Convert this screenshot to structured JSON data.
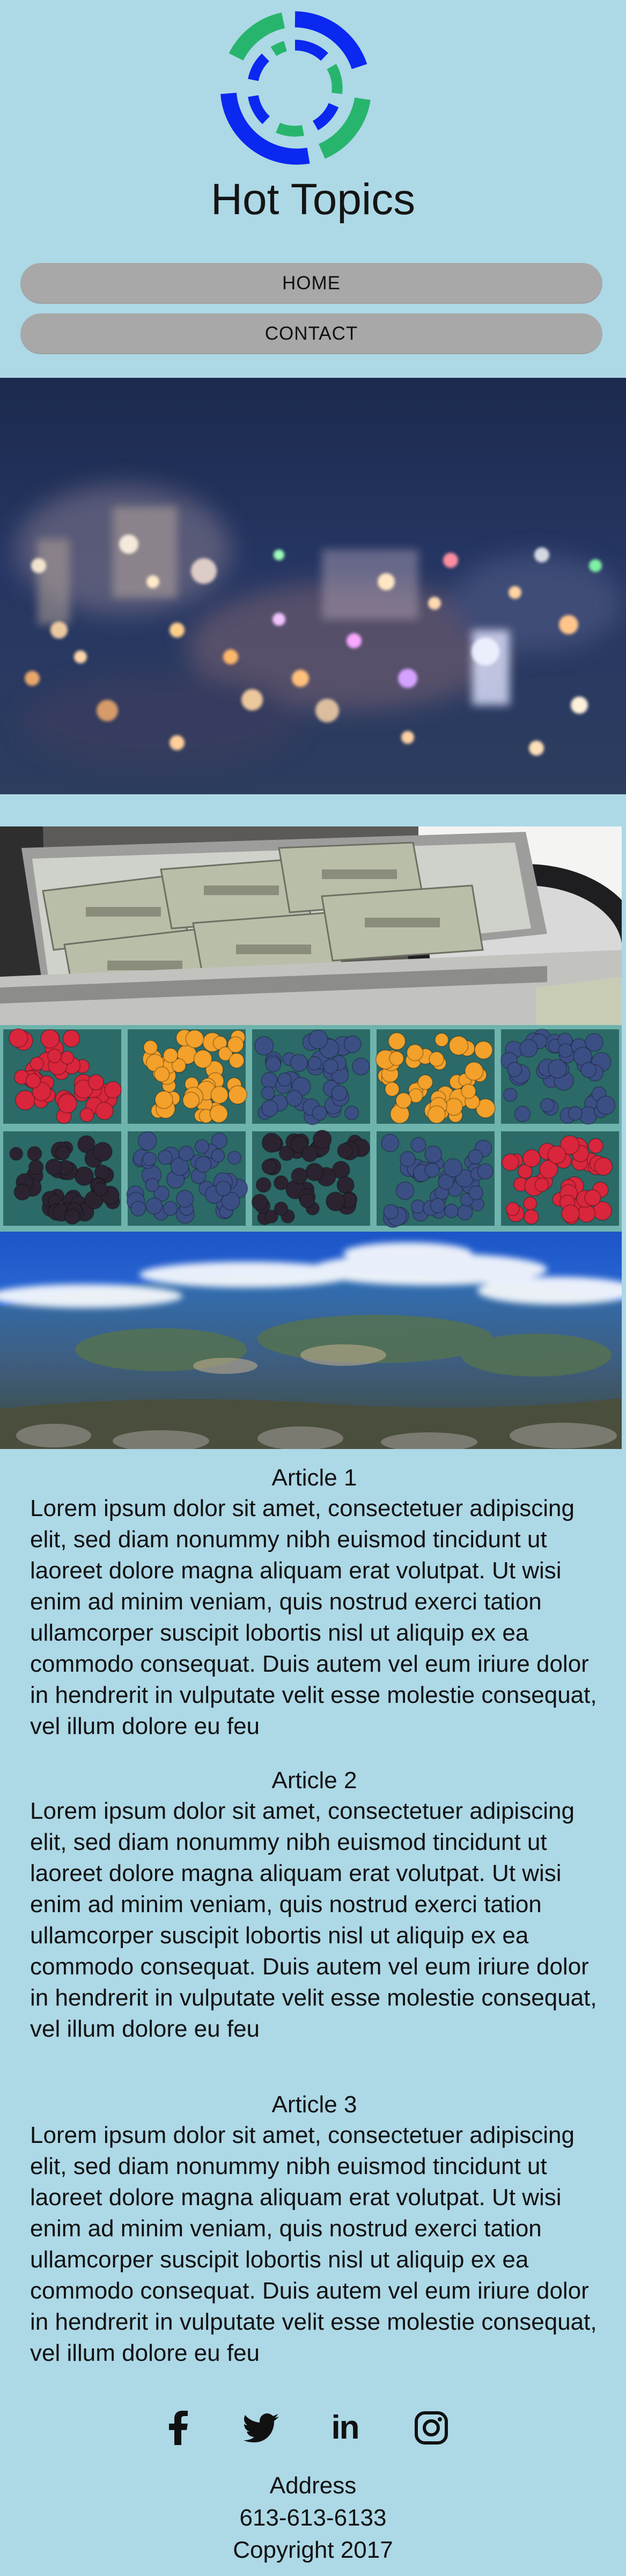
{
  "site": {
    "title": "Hot Topics",
    "logo_icon": "circular-segmented-logo-icon",
    "colors": {
      "background": "#add8e6",
      "logo_blue": "#0a28f0",
      "logo_green": "#27b56e",
      "nav_button": "#a8a8a8"
    }
  },
  "nav": {
    "home_label": "HOME",
    "contact_label": "CONTACT"
  },
  "images": {
    "hero": "blurred-city-lights-night-image",
    "money": "cash-briefcase-image",
    "berries": "berry-baskets-image",
    "earth": "earth-from-space-image"
  },
  "articles": [
    {
      "title": "Article 1",
      "body": "Lorem ipsum dolor sit amet, consectetuer adipiscing elit, sed diam nonummy nibh euismod tincidunt ut laoreet dolore magna aliquam erat volutpat. Ut wisi enim ad minim veniam, quis nostrud exerci tation ullamcorper suscipit lobortis nisl ut aliquip ex ea commodo consequat. Duis autem vel eum iriure dolor in hendrerit in vulputate velit esse molestie consequat, vel illum dolore eu feu"
    },
    {
      "title": "Article 2",
      "body": "Lorem ipsum dolor sit amet, consectetuer adipiscing elit, sed diam nonummy nibh euismod tincidunt ut laoreet dolore magna aliquam erat volutpat. Ut wisi enim ad minim veniam, quis nostrud exerci tation ullamcorper suscipit lobortis nisl ut aliquip ex ea commodo consequat. Duis autem vel eum iriure dolor in hendrerit in vulputate velit esse molestie consequat, vel illum dolore eu feu"
    },
    {
      "title": "Article 3",
      "body": "Lorem ipsum dolor sit amet, consectetuer adipiscing elit, sed diam nonummy nibh euismod tincidunt ut laoreet dolore magna aliquam erat volutpat. Ut wisi enim ad minim veniam, quis nostrud exerci tation ullamcorper suscipit lobortis nisl ut aliquip ex ea commodo consequat. Duis autem vel eum iriure dolor in hendrerit in vulputate velit esse molestie consequat, vel illum dolore eu feu"
    }
  ],
  "social": {
    "icons": [
      "facebook-icon",
      "twitter-icon",
      "linkedin-icon",
      "instagram-icon"
    ],
    "linkedin_text": "in"
  },
  "footer": {
    "address": "Address",
    "phone": "613-613-6133",
    "copyright": "Copyright 2017"
  }
}
